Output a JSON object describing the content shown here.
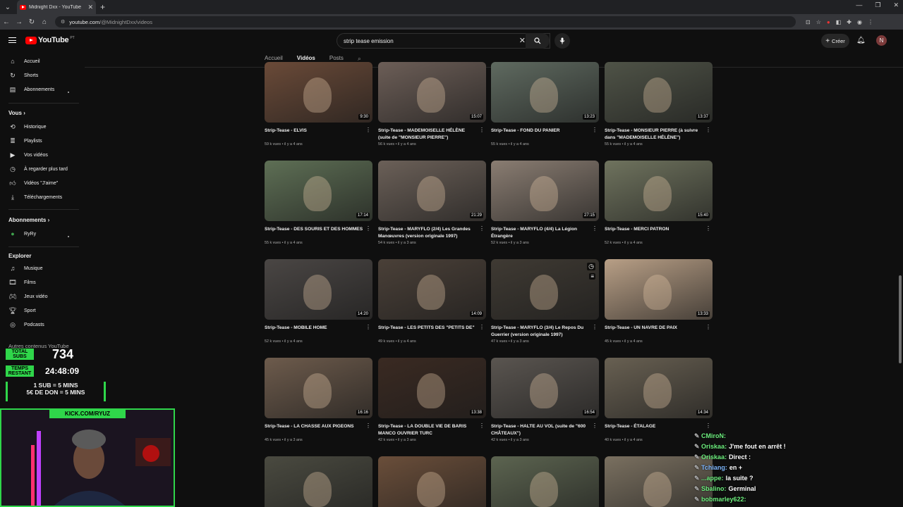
{
  "browser": {
    "tab_title": "Midnight Dxx - YouTube",
    "url_host": "youtube.com",
    "url_path": "/@MidnightDxx/videos"
  },
  "masthead": {
    "logo_text": "YouTube",
    "country_code": "PT",
    "search_value": "strip tease emission",
    "create_label": "Créer",
    "avatar_letter": "N"
  },
  "sidebar": {
    "main": [
      {
        "label": "Accueil",
        "icon": "home-icon"
      },
      {
        "label": "Shorts",
        "icon": "shorts-icon"
      },
      {
        "label": "Abonnements",
        "icon": "subscriptions-icon"
      }
    ],
    "you_header": "Vous",
    "you": [
      {
        "label": "Historique",
        "icon": "history-icon"
      },
      {
        "label": "Playlists",
        "icon": "playlists-icon"
      },
      {
        "label": "Vos vidéos",
        "icon": "your-videos-icon"
      },
      {
        "label": "À regarder plus tard",
        "icon": "watch-later-icon"
      },
      {
        "label": "Vidéos \"J'aime\"",
        "icon": "liked-icon"
      },
      {
        "label": "Téléchargements",
        "icon": "download-icon"
      }
    ],
    "subs_header": "Abonnements",
    "subs": [
      {
        "label": "RyRy",
        "icon": "channel-avatar"
      }
    ],
    "explore_header": "Explorer",
    "explore": [
      {
        "label": "Musique",
        "icon": "music-icon"
      },
      {
        "label": "Films",
        "icon": "film-icon"
      },
      {
        "label": "Jeux vidéo",
        "icon": "gaming-icon"
      },
      {
        "label": "Sport",
        "icon": "trophy-icon"
      },
      {
        "label": "Podcasts",
        "icon": "podcast-icon"
      }
    ],
    "other_header": "Autres contenus YouTube"
  },
  "channel_tabs": [
    "Accueil",
    "Vidéos",
    "Posts"
  ],
  "videos": [
    {
      "title": "Strip-Tease - ELVIS",
      "meta": "59 k vues • il y a 4 ans",
      "duration": "9:30",
      "color": "#6a4a38"
    },
    {
      "title": "Strip-Tease - MADEMOISELLE HÉLÈNE (suite de \"MONSIEUR PIERRE\")",
      "meta": "56 k vues • il y a 4 ans",
      "duration": "15:07",
      "color": "#6c5e57"
    },
    {
      "title": "Strip-Tease - FOND DU PANIER",
      "meta": "55 k vues • il y a 4 ans",
      "duration": "13:23",
      "color": "#5f6a60"
    },
    {
      "title": "Strip-Tease - MONSIEUR PIERRE (à suivre dans \"MADEMOISELLE HÉLÈNE\")",
      "meta": "55 k vues • il y a 4 ans",
      "duration": "13:37",
      "color": "#4f5347"
    },
    {
      "title": "Strip-Tease - DES SOURIS ET DES HOMMES",
      "meta": "55 k vues • il y a 4 ans",
      "duration": "17:14",
      "color": "#5e6f55"
    },
    {
      "title": "Strip-Tease - MARYFLO (2/4) Les Grandes Manœuvres (version originale 1997)",
      "meta": "54 k vues • il y a 3 ans",
      "duration": "21:29",
      "color": "#6b6058"
    },
    {
      "title": "Strip-Tease - MARYFLO (4/4) La Légion Étrangère",
      "meta": "52 k vues • il y a 3 ans",
      "duration": "27:15",
      "color": "#8a7d72"
    },
    {
      "title": "Strip-Tease - MERCI PATRON",
      "meta": "52 k vues • il y a 4 ans",
      "duration": "15:40",
      "color": "#6f735e"
    },
    {
      "title": "Strip-Tease - MOBILE HOME",
      "meta": "52 k vues • il y a 4 ans",
      "duration": "14:20",
      "color": "#4a4644"
    },
    {
      "title": "Strip-Tease - LES PETITS DES \"PETITS DE\"",
      "meta": "49 k vues • il y a 4 ans",
      "duration": "14:09",
      "color": "#4a4038"
    },
    {
      "title": "Strip-Tease - MARYFLO (3/4) Le Repos Du Guerrier (version originale 1997)",
      "meta": "47 k vues • il y a 3 ans",
      "duration": "",
      "color": "#3f3a33"
    },
    {
      "title": "Strip-Tease - UN NAVRE DE PAIX",
      "meta": "45 k vues • il y a 4 ans",
      "duration": "13:33",
      "color": "#b89f86"
    },
    {
      "title": "Strip-Tease - LA CHASSE AUX PIGEONS",
      "meta": "45 k vues • il y a 3 ans",
      "duration": "16:16",
      "color": "#6d5b4c"
    },
    {
      "title": "Strip-Tease - LA DOUBLE VIE DE BARIS MANCO OUVRIER TURC",
      "meta": "42 k vues • il y a 3 ans",
      "duration": "13:38",
      "color": "#3a2a22"
    },
    {
      "title": "Strip-Tease - HALTE AU VOL (suite de \"600 CHÂTEAUX\")",
      "meta": "42 k vues • il y a 3 ans",
      "duration": "16:54",
      "color": "#5a5550"
    },
    {
      "title": "Strip-Tease - ÉTALAGE",
      "meta": "40 k vues • il y a 4 ans",
      "duration": "14:34",
      "color": "#686052"
    },
    {
      "title": "",
      "meta": "",
      "duration": "",
      "color": "#4a4a40"
    },
    {
      "title": "",
      "meta": "",
      "duration": "",
      "color": "#6a4e3a"
    },
    {
      "title": "",
      "meta": "",
      "duration": "",
      "color": "#5c6450"
    },
    {
      "title": "",
      "meta": "",
      "duration": "",
      "color": "#7a7060"
    }
  ],
  "overlay": {
    "total_subs_label": "TOTAL SUBS",
    "total_subs_value": "734",
    "time_label": "TEMPS RESTANT",
    "time_value": "24:48:09",
    "rule1": "1 SUB = 5 MINS",
    "rule2": "5€ DE DON = 5 MINS",
    "kick_url": "KICK.COM/RYUZ"
  },
  "chat": [
    {
      "user": "CMiroN:",
      "msg": "",
      "cls": "n"
    },
    {
      "user": "Oriskaa:",
      "msg": "J'me fout en arrêt !",
      "cls": "n"
    },
    {
      "user": "Oriskaa:",
      "msg": "Direct :",
      "cls": "n"
    },
    {
      "user": "Tchiang:",
      "msg": "en +",
      "cls": "n3"
    },
    {
      "user": "...appe:",
      "msg": "la suite ?",
      "cls": "n"
    },
    {
      "user": "Sbalino:",
      "msg": "Germinal",
      "cls": "n"
    },
    {
      "user": "bobmarley622:",
      "msg": "",
      "cls": "n"
    }
  ]
}
